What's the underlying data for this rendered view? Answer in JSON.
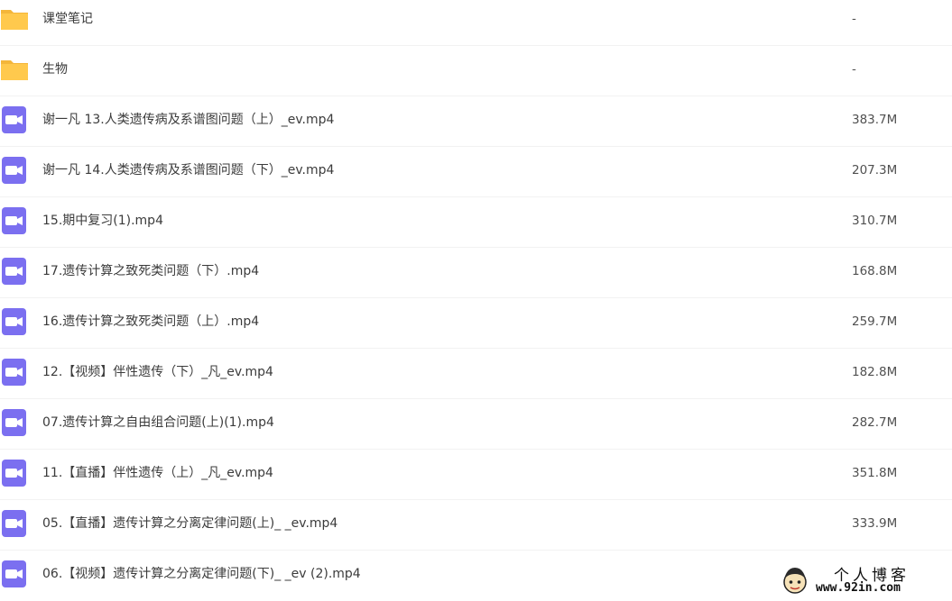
{
  "files": [
    {
      "type": "folder",
      "icon": "folder-icon",
      "name": "课堂笔记",
      "size": "-"
    },
    {
      "type": "folder",
      "icon": "folder-icon",
      "name": "生物",
      "size": "-"
    },
    {
      "type": "video",
      "icon": "video-file-icon",
      "name": "谢一凡 13.人类遗传病及系谱图问题（上）_ev.mp4",
      "size": "383.7M"
    },
    {
      "type": "video",
      "icon": "video-file-icon",
      "name": "谢一凡 14.人类遗传病及系谱图问题（下）_ev.mp4",
      "size": "207.3M"
    },
    {
      "type": "video",
      "icon": "video-file-icon",
      "name": "15.期中复习(1).mp4",
      "size": "310.7M"
    },
    {
      "type": "video",
      "icon": "video-file-icon",
      "name": "17.遗传计算之致死类问题（下）.mp4",
      "size": "168.8M"
    },
    {
      "type": "video",
      "icon": "video-file-icon",
      "name": "16.遗传计算之致死类问题（上）.mp4",
      "size": "259.7M"
    },
    {
      "type": "video",
      "icon": "video-file-icon",
      "name": "12.【视频】伴性遗传（下）_凡_ev.mp4",
      "size": "182.8M"
    },
    {
      "type": "video",
      "icon": "video-file-icon",
      "name": "07.遗传计算之自由组合问题(上)(1).mp4",
      "size": "282.7M"
    },
    {
      "type": "video",
      "icon": "video-file-icon",
      "name": "11.【直播】伴性遗传（上）_凡_ev.mp4",
      "size": "351.8M"
    },
    {
      "type": "video",
      "icon": "video-file-icon",
      "name": "05.【直播】遗传计算之分离定律问题(上)_ _ev.mp4",
      "size": "333.9M"
    },
    {
      "type": "video",
      "icon": "video-file-icon",
      "name": "06.【视频】遗传计算之分离定律问题(下)_ _ev (2).mp4",
      "size": ""
    }
  ],
  "colors": {
    "folder": "#ffc94d",
    "folder_tab": "#f4b63a",
    "video": "#7b6ff0"
  },
  "watermark": {
    "title": "个人博客",
    "url": "www.92in.com"
  }
}
